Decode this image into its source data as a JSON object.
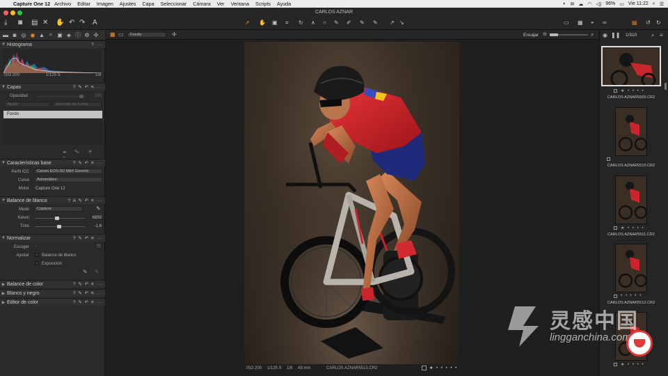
{
  "menubar": {
    "app_name": "Capture One 12",
    "items": [
      "Archivo",
      "Editar",
      "Imagen",
      "Ajustes",
      "Capa",
      "Seleccionar",
      "Cámara",
      "Ver",
      "Ventana",
      "Scripts",
      "Ayuda"
    ],
    "battery": "96%",
    "clock": "Vie 11:22"
  },
  "window": {
    "title": "CARLOS AZNAR"
  },
  "viewer_bar": {
    "layer_select": "Fondo",
    "fit_label": "Encajar"
  },
  "browser_bar": {
    "counter": "1/310"
  },
  "histogram": {
    "title": "Histograma",
    "iso": "ISO 200",
    "shutter": "1/125 S",
    "aperture": "1/8"
  },
  "layers": {
    "title": "Capas",
    "opacity_label": "Opacidad",
    "opacity_value": "100",
    "adjust_label": "Ajuste",
    "range_label": "Intervalo de Luma...",
    "layer_name": "Fondo"
  },
  "base": {
    "title": "Características base",
    "icc_label": "Perfil ICC",
    "icc_value": "Canon EOS-5D MkII Generic",
    "curve_label": "Curva",
    "curve_value": "Automático",
    "engine_label": "Motor",
    "engine_value": "Capture One 12"
  },
  "wb": {
    "title": "Balance de blanco",
    "mode_label": "Modo",
    "mode_value": "Captura",
    "kelvin_label": "Kelvin",
    "kelvin_value": "6859",
    "kelvin_fraction": 0.45,
    "tint_label": "Tinte",
    "tint_value": "-1,6",
    "tint_fraction": 0.49
  },
  "normalize": {
    "title": "Normalizar",
    "pick_label": "Escoger",
    "pick_value": "--",
    "adjust_label": "Ajustar",
    "opt_wb": "Balance de blanco",
    "opt_exposure": "Exposición"
  },
  "collapsed_sections": [
    "Balance de color",
    "Blanco y negro",
    "Editor de color"
  ],
  "viewer_status": {
    "iso": "ISO 200",
    "shutter": "1/125 S",
    "aperture": "1/8",
    "focal": "43 mm",
    "filename": "CARLOS AZNAR5513.CR2",
    "rating": "★ • • • • •"
  },
  "thumbnails": [
    {
      "name": "CARLOS AZNAR5509.CR2",
      "rating": "★ • • • •",
      "selected": true
    },
    {
      "name": "CARLOS AZNAR5510.CR2",
      "rating": "",
      "selected": false
    },
    {
      "name": "CARLOS AZNAR5511.CR2",
      "rating": "★ • • • •",
      "selected": false
    },
    {
      "name": "CARLOS AZNAR5512.CR2",
      "rating": "• • • • •",
      "selected": false
    },
    {
      "name": "",
      "rating": "★ • • • •",
      "selected": false
    }
  ],
  "watermark": {
    "brand_cn": "灵感中国",
    "domain": "lingganchina.com"
  },
  "colors": {
    "accent_orange": "#f0902a",
    "panel_bg": "#2a2a2a",
    "viewer_bg": "#1f1f1f",
    "jersey_red": "#d2262a"
  },
  "icons": [
    "apple-icon",
    "import-icon",
    "camera-icon",
    "delete-icon",
    "undo-icon",
    "redo-icon",
    "text-icon",
    "cursor-tool-icon",
    "pan-tool-icon",
    "crop-tool-icon",
    "rotate-tool-icon",
    "keystone-icon",
    "spot-icon",
    "brush-icon",
    "eraser-icon",
    "gradient-icon",
    "picker-icon",
    "copy-adjust-icon",
    "apply-adjust-icon",
    "grid-icon",
    "loupe-icon",
    "glasses-icon",
    "export-icon",
    "search-icon",
    "eye-icon",
    "help-icon",
    "menu-dots-icon"
  ]
}
